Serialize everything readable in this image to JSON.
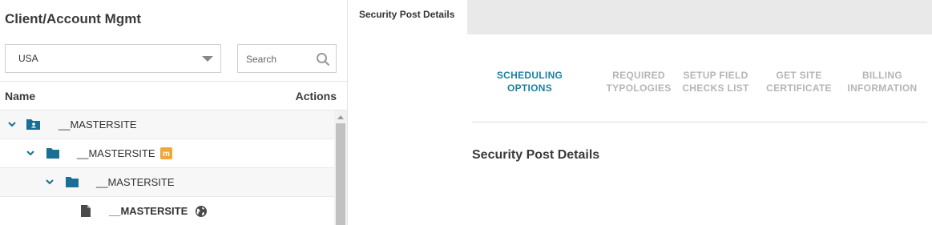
{
  "left_panel": {
    "title": "Client/Account Mgmt",
    "region_select": {
      "value": "USA"
    },
    "search": {
      "placeholder": "Search"
    },
    "columns": {
      "name": "Name",
      "actions": "Actions"
    },
    "tree": [
      {
        "label": "__MASTERSITE",
        "icon": "account-folder-icon",
        "expanded": true
      },
      {
        "label": "__MASTERSITE",
        "icon": "folder-icon",
        "badge": "m",
        "expanded": true
      },
      {
        "label": "__MASTERSITE",
        "icon": "folder-icon",
        "expanded": true
      },
      {
        "label": "__MASTERSITE",
        "icon": "document-icon",
        "trailing_icon": "globe-icon"
      }
    ]
  },
  "tabs": [
    {
      "label": "Security Post Details",
      "active": true
    }
  ],
  "steps": [
    {
      "label": "SCHEDULING OPTIONS",
      "line1": "SCHEDULING",
      "line2": "OPTIONS",
      "active": true
    },
    {
      "label": "REQUIRED TYPOLOGIES",
      "line1": "REQUIRED",
      "line2": "TYPOLOGIES",
      "active": false
    },
    {
      "label": "SETUP FIELD CHECKS LIST",
      "line1": "SETUP FIELD",
      "line2": "CHECKS LIST",
      "active": false
    },
    {
      "label": "GET SITE CERTIFICATE",
      "line1": "GET SITE",
      "line2": "CERTIFICATE",
      "active": false
    },
    {
      "label": "BILLING INFORMATION",
      "line1": "BILLING",
      "line2": "INFORMATION",
      "active": false
    }
  ],
  "main": {
    "section_title": "Security Post Details"
  },
  "colors": {
    "accent": "#1d7fa3",
    "icon_blue": "#1a6f96",
    "badge_orange": "#f0a63a",
    "inactive_step": "#b5b5b5"
  }
}
